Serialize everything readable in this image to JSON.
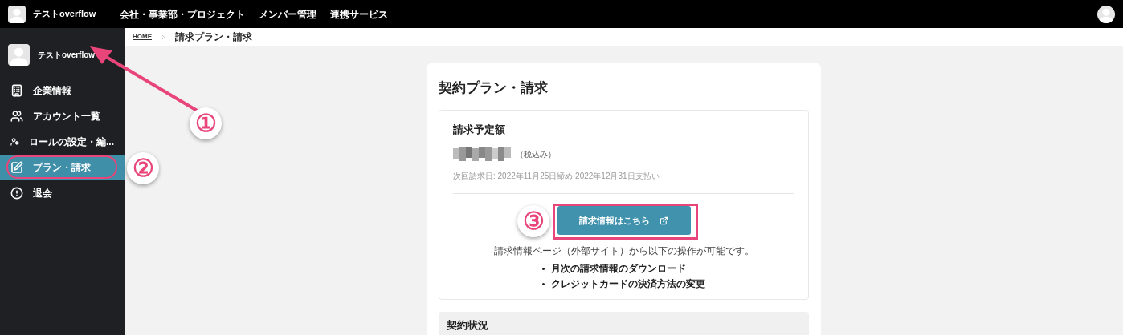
{
  "header": {
    "user_name": "テストoverflow",
    "nav": [
      {
        "label": "会社・事業部・プロジェクト"
      },
      {
        "label": "メンバー管理"
      },
      {
        "label": "連携サービス"
      }
    ]
  },
  "sidebar": {
    "user_name": "テストoverflow",
    "items": [
      {
        "label": "企業情報",
        "selected": false
      },
      {
        "label": "アカウント一覧",
        "selected": false
      },
      {
        "label": "ロールの設定・編...",
        "selected": false
      },
      {
        "label": "プラン・請求",
        "selected": true
      },
      {
        "label": "退会",
        "selected": false
      }
    ]
  },
  "breadcrumb": [
    {
      "label": "HOME",
      "kind": "link"
    },
    {
      "label": "請求プラン・請求",
      "kind": "current"
    }
  ],
  "page_title": "契約プラン・請求",
  "billing": {
    "heading": "請求予定額",
    "amount_note": "（税込み）",
    "next_billing": "次回請求日: 2022年11月25日締め 2022年12月31日支払い",
    "button": "請求情報はこちら",
    "description": "請求情報ページ（外部サイト）から以下の操作が可能です。",
    "bullets": [
      "月次の請求情報のダウンロード",
      "クレジットカードの決済方法の変更"
    ]
  },
  "status_section": {
    "heading": "契約状況"
  },
  "annotations": [
    {
      "label": "①"
    },
    {
      "label": "②"
    },
    {
      "label": "③"
    }
  ]
}
